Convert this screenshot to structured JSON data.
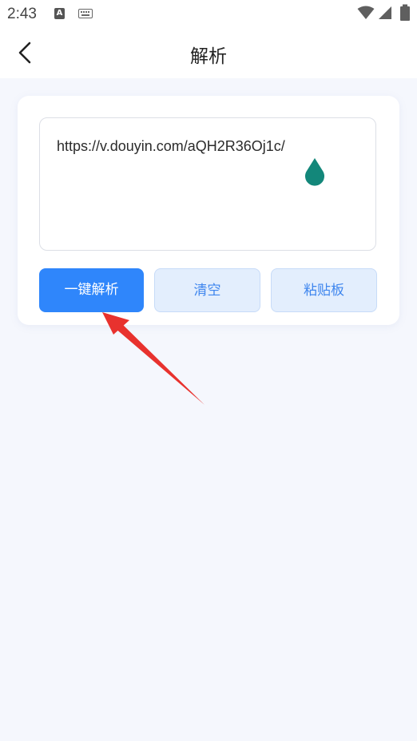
{
  "status_bar": {
    "time": "2:43",
    "app_icon_letter": "A",
    "icons": [
      "notification-app-icon",
      "keyboard-icon",
      "wifi-icon",
      "signal-icon",
      "battery-icon"
    ]
  },
  "nav": {
    "title": "解析",
    "back_icon": "chevron-left-icon"
  },
  "input": {
    "value": "https://v.douyin.com/aQH2R36Oj1c/"
  },
  "buttons": {
    "parse": "一键解析",
    "clear": "清空",
    "paste": "粘贴板"
  },
  "colors": {
    "primary": "#2f86fb",
    "secondary_bg": "#e3eefd",
    "secondary_text": "#3f86ee",
    "page_bg": "#f5f7fd",
    "cursor_handle": "#13877a",
    "annotation_arrow": "#e8322e"
  }
}
